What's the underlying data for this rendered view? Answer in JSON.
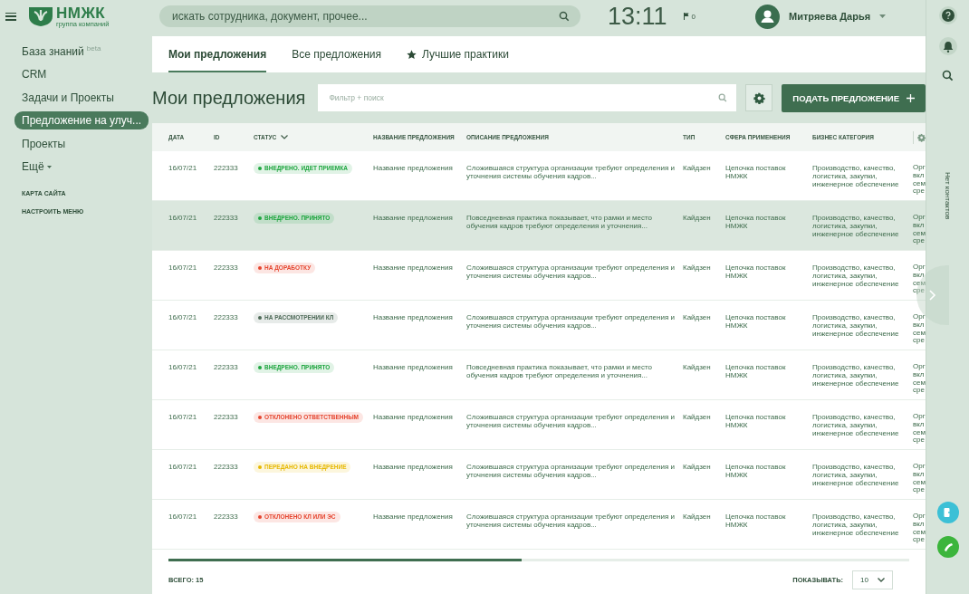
{
  "logo": {
    "name": "НМЖК",
    "subtitle": "группа компаний"
  },
  "search": {
    "placeholder": "искать сотрудника, документ, прочее..."
  },
  "clock": "13:11",
  "flags": "0",
  "user": {
    "name": "Митряева Дарья"
  },
  "sidebar": {
    "items": [
      {
        "label": "База знаний",
        "badge": "beta",
        "selected": false
      },
      {
        "label": "CRM",
        "selected": false
      },
      {
        "label": "Задачи и Проекты",
        "selected": false
      },
      {
        "label": "Предложение на улуч...",
        "selected": true
      },
      {
        "label": "Проекты",
        "selected": false
      },
      {
        "label": "Ещё",
        "selected": false,
        "caret": true
      }
    ],
    "links": [
      "КАРТА САЙТА",
      "НАСТРОИТЬ МЕНЮ"
    ]
  },
  "tabs": [
    {
      "label": "Мои предложения",
      "selected": true
    },
    {
      "label": "Все предложения",
      "selected": false
    },
    {
      "label": "Лучшие практики",
      "selected": false,
      "star": true
    }
  ],
  "page_title": "Мои предложения",
  "filter": {
    "placeholder": "Фильтр + поиск"
  },
  "submit_button": "ПОДАТЬ ПРЕДЛОЖЕНИЕ",
  "table": {
    "columns": [
      "ДАТА",
      "ID",
      "СТАТУС",
      "НАЗВАНИЕ ПРЕДЛОЖЕНИЯ",
      "ОПИСАНИЕ ПРЕДЛОЖЕНИЯ",
      "ТИП",
      "СФЕРА ПРИМЕНЕНИЯ",
      "БИЗНЕС КАТЕГОРИЯ"
    ],
    "rows": [
      {
        "selected": false,
        "date": "16/07/21",
        "id": "222333",
        "status": "ВНЕДРЕНО. ИДЕТ ПРИЕМКА",
        "color": "#1fa640",
        "name": "Название предложения",
        "description": "Сложившаяся структура организации требуют определения и уточнения системы обучения кадров...",
        "type": "Кайдзен",
        "sphere": "Цепочка поставок НМЖК",
        "category": "Производство, качество, логистика, закупки, инженерное обеспечение",
        "column_9": "Орг вкл сем сре"
      },
      {
        "selected": true,
        "date": "16/07/21",
        "id": "222333",
        "status": "ВНЕДРЕНО. ПРИНЯТО",
        "color": "#1fa640",
        "name": "Название предложения",
        "description": "Повседневная практика показывает, что рамки и место обучения кадров требуют определения и уточнения...",
        "type": "Кайдзен",
        "sphere": "Цепочка поставок НМЖК",
        "category": "Производство, качество, логистика, закупки, инженерное обеспечение",
        "column_9": "Орг вкл сем сре"
      },
      {
        "selected": false,
        "date": "16/07/21",
        "id": "222333",
        "status": "НА ДОРАБОТКУ",
        "color": "#e5452f",
        "name": "Название предложения",
        "description": "Сложившаяся структура организации требуют определения и уточнения системы обучения кадров...",
        "type": "Кайдзен",
        "sphere": "Цепочка поставок НМЖК",
        "category": "Производство, качество, логистика, закупки, инженерное обеспечение",
        "column_9": "Орг вкл сем сре"
      },
      {
        "selected": false,
        "date": "16/07/21",
        "id": "222333",
        "status": "НА РАССМОТРЕНИИ КЛ",
        "color": "#4e6a58",
        "name": "Название предложения",
        "description": "Сложившаяся структура организации требуют определения и уточнения системы обучения кадров...",
        "type": "Кайдзен",
        "sphere": "Цепочка поставок НМЖК",
        "category": "Производство, качество, логистика, закупки, инженерное обеспечение",
        "column_9": "Орг вкл сем сре"
      },
      {
        "selected": false,
        "date": "16/07/21",
        "id": "222333",
        "status": "ВНЕДРЕНО. ПРИНЯТО",
        "color": "#1fa640",
        "name": "Название предложения",
        "description": "Повседневная практика показывает, что рамки и место обучения кадров требуют определения и уточнения...",
        "type": "Кайдзен",
        "sphere": "Цепочка поставок НМЖК",
        "category": "Производство, качество, логистика, закупки, инженерное обеспечение",
        "column_9": "Орг вкл сем сре"
      },
      {
        "selected": false,
        "date": "16/07/21",
        "id": "222333",
        "status": "ОТКЛОНЕНО ОТВЕТСТВЕННЫМ",
        "color": "#e5452f",
        "name": "Название предложения",
        "description": "Сложившаяся структура организации требуют определения и уточнения системы обучения кадров...",
        "type": "Кайдзен",
        "sphere": "Цепочка поставок НМЖК",
        "category": "Производство, качество, логистика, закупки, инженерное обеспечение",
        "column_9": "Орг вкл сем сре"
      },
      {
        "selected": false,
        "date": "16/07/21",
        "id": "222333",
        "status": "ПЕРЕДАНО НА ВНЕДРЕНИЕ",
        "color": "#e6b800",
        "name": "Название предложения",
        "description": "Сложившаяся структура организации требуют определения и уточнения системы обучения кадров...",
        "type": "Кайдзен",
        "sphere": "Цепочка поставок НМЖК",
        "category": "Производство, качество, логистика, закупки, инженерное обеспечение",
        "column_9": "Орг вкл сем сре"
      },
      {
        "selected": false,
        "date": "16/07/21",
        "id": "222333",
        "status": "ОТКЛОНЕНО КЛ ИЛИ ЭС",
        "color": "#e5452f",
        "name": "Название предложения",
        "description": "Сложившаяся структура организации требуют определения и уточнения системы обучения кадров...",
        "type": "Кайдзен",
        "sphere": "Цепочка поставок НМЖК",
        "category": "Производство, качество, логистика, закупки, инженерное обеспечение",
        "column_9": "Орг вкл сем сре"
      }
    ]
  },
  "total": "ВСЕГО: 15",
  "page_size": {
    "label": "ПОКАЗЫВАТЬ:",
    "value": "10"
  },
  "contacts": "Нет контактов"
}
